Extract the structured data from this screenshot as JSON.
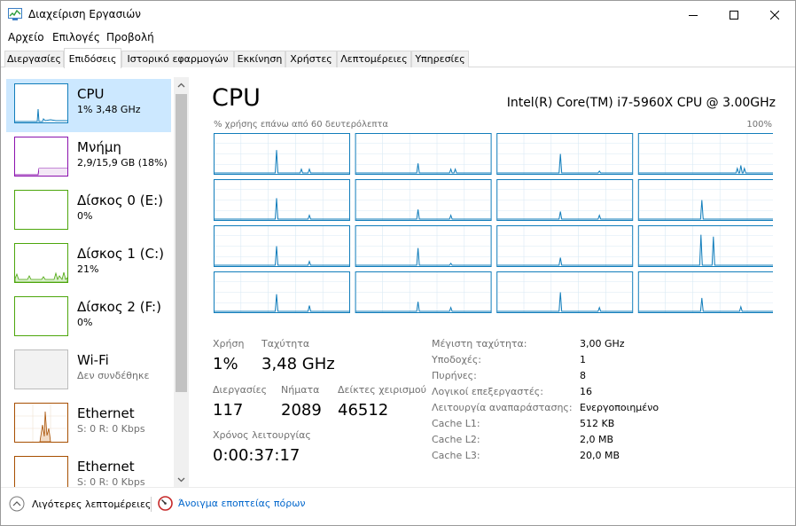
{
  "window": {
    "title": "Διαχείριση Εργασιών"
  },
  "menu": {
    "items": [
      "Αρχείο",
      "Επιλογές",
      "Προβολή"
    ]
  },
  "tabs": [
    {
      "label": "Διεργασίες",
      "active": false
    },
    {
      "label": "Επιδόσεις",
      "active": true
    },
    {
      "label": "Ιστορικό εφαρμογών",
      "active": false
    },
    {
      "label": "Εκκίνηση",
      "active": false
    },
    {
      "label": "Χρήστες",
      "active": false
    },
    {
      "label": "Λεπτομέρειες",
      "active": false
    },
    {
      "label": "Υπηρεσίες",
      "active": false
    }
  ],
  "sidebar": {
    "items": [
      {
        "title": "CPU",
        "subtitle": "1% 3,48 GHz",
        "color": "#117dbb"
      },
      {
        "title": "Μνήμη",
        "subtitle": "2,9/15,9 GB (18%)",
        "color": "#8b12ae"
      },
      {
        "title": "Δίσκος 0 (E:)",
        "subtitle": "0%",
        "color": "#4da60c"
      },
      {
        "title": "Δίσκος 1 (C:)",
        "subtitle": "21%",
        "color": "#4da60c"
      },
      {
        "title": "Δίσκος 2 (F:)",
        "subtitle": "0%",
        "color": "#4da60c"
      },
      {
        "title": "Wi-Fi",
        "subtitle": "Δεν συνδέθηκε",
        "color": "#bcbcbc"
      },
      {
        "title": "Ethernet",
        "subtitle": "S: 0 R: 0 Kbps",
        "color": "#a74f01"
      },
      {
        "title": "Ethernet",
        "subtitle": "S: 0 R: 0 Kbps",
        "color": "#a74f01"
      }
    ]
  },
  "main": {
    "title": "CPU",
    "model": "Intel(R) Core(TM) i7-5960X CPU @ 3.00GHz",
    "graph_caption": "% χρήσης επάνω από 60 δευτερόλεπτα",
    "graph_max": "100%",
    "core_count": 16
  },
  "stats": {
    "utilization_label": "Χρήση",
    "utilization_value": "1%",
    "speed_label": "Ταχύτητα",
    "speed_value": "3,48 GHz",
    "processes_label": "Διεργασίες",
    "processes_value": "117",
    "threads_label": "Νήματα",
    "threads_value": "2089",
    "handles_label": "Δείκτες χειρισμού",
    "handles_value": "46512",
    "uptime_label": "Χρόνος λειτουργίας",
    "uptime_value": "0:00:37:17"
  },
  "specs": [
    {
      "label": "Μέγιστη ταχύτητα:",
      "value": "3,00 GHz"
    },
    {
      "label": "Υποδοχές:",
      "value": "1"
    },
    {
      "label": "Πυρήνες:",
      "value": "8"
    },
    {
      "label": "Λογικοί επεξεργαστές:",
      "value": "16"
    },
    {
      "label": "Λειτουργία αναπαράστασης:",
      "value": "Ενεργοποιημένο"
    },
    {
      "label": "Cache L1:",
      "value": "512 KB"
    },
    {
      "label": "Cache L2:",
      "value": "2,0 MB"
    },
    {
      "label": "Cache L3:",
      "value": "20,0 MB"
    }
  ],
  "footer": {
    "fewer_details": "Λιγότερες λεπτομέρειες",
    "resource_monitor": "Άνοιγμα εποπτείας πόρων"
  },
  "colors": {
    "cpu": "#117dbb",
    "memory": "#8b12ae",
    "disk": "#4da60c",
    "ethernet": "#a74f01",
    "selected": "#cce8ff",
    "link": "#0066cc"
  }
}
